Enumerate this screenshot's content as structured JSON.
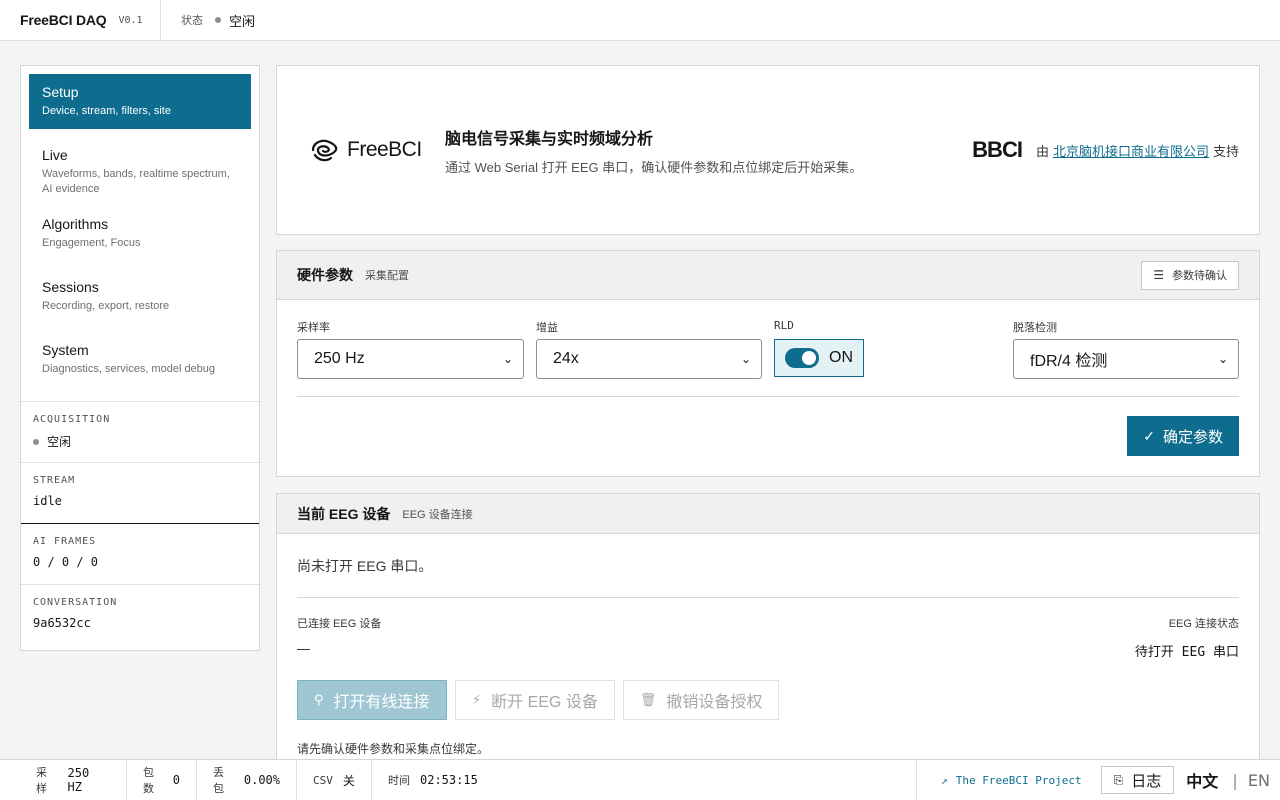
{
  "app": {
    "name": "FreeBCI DAQ",
    "version": "V0.1",
    "status_label": "状态",
    "status_value": "空闲"
  },
  "sidebar": {
    "items": [
      {
        "label": "Setup",
        "desc": "Device, stream, filters, site"
      },
      {
        "label": "Live",
        "desc": "Waveforms, bands, realtime spectrum, AI evidence"
      },
      {
        "label": "Algorithms",
        "desc": "Engagement, Focus"
      },
      {
        "label": "Sessions",
        "desc": "Recording, export, restore"
      },
      {
        "label": "System",
        "desc": "Diagnostics, services, model debug"
      }
    ],
    "acquisition": {
      "label": "ACQUISITION",
      "value": "空闲"
    },
    "stream": {
      "label": "STREAM",
      "value": "idle"
    },
    "ai_frames": {
      "label": "AI FRAMES",
      "value": "0 / 0 / 0"
    },
    "conversation": {
      "label": "CONVERSATION",
      "value": "9a6532cc"
    }
  },
  "hero": {
    "logo_text": "FreeBCI",
    "title": "脑电信号采集与实时频域分析",
    "subtitle": "通过 Web Serial 打开 EEG 串口，确认硬件参数和点位绑定后开始采集。",
    "partner_logo": "BBCI",
    "support_prefix": "由",
    "support_link": "北京脑机接口商业有限公司",
    "support_suffix": "支持"
  },
  "hardware": {
    "title": "硬件参数",
    "subtitle": "采集配置",
    "pending_label": "参数待确认",
    "sample_rate": {
      "label": "采样率",
      "value": "250 Hz"
    },
    "gain": {
      "label": "增益",
      "value": "24x"
    },
    "rld": {
      "label": "RLD",
      "value": "ON"
    },
    "leadoff": {
      "label": "脱落检测",
      "value": "fDR/4 检测"
    },
    "confirm_label": "确定参数"
  },
  "eeg": {
    "title": "当前 EEG 设备",
    "subtitle": "EEG 设备连接",
    "message": "尚未打开 EEG 串口。",
    "connected_label": "已连接 EEG 设备",
    "connected_value": "—",
    "state_label": "EEG 连接状态",
    "state_value": "待打开 EEG 串口",
    "open_label": "打开有线连接",
    "disconnect_label": "断开 EEG 设备",
    "revoke_label": "撤销设备授权",
    "hint": "请先确认硬件参数和采集点位绑定。"
  },
  "footer": {
    "sample_label": "采样",
    "sample_value": "250 HZ",
    "packets_label": "包数",
    "packets_value": "0",
    "loss_label": "丢包",
    "loss_value": "0.00%",
    "csv_label": "CSV",
    "csv_value": "关",
    "time_label": "时间",
    "time_value": "02:53:15",
    "project_link": "The FreeBCI Project",
    "log_label": "日志",
    "lang_zh": "中文",
    "lang_en": "EN"
  },
  "colors": {
    "accent": "#0e6d8e",
    "status_idle": "#8d8d8d"
  },
  "icons": [
    "settings-sliders-icon",
    "check-icon",
    "plug-icon",
    "unplug-icon",
    "trash-icon",
    "external-link-icon",
    "log-icon",
    "freebci-logo",
    "bbci-logo"
  ]
}
